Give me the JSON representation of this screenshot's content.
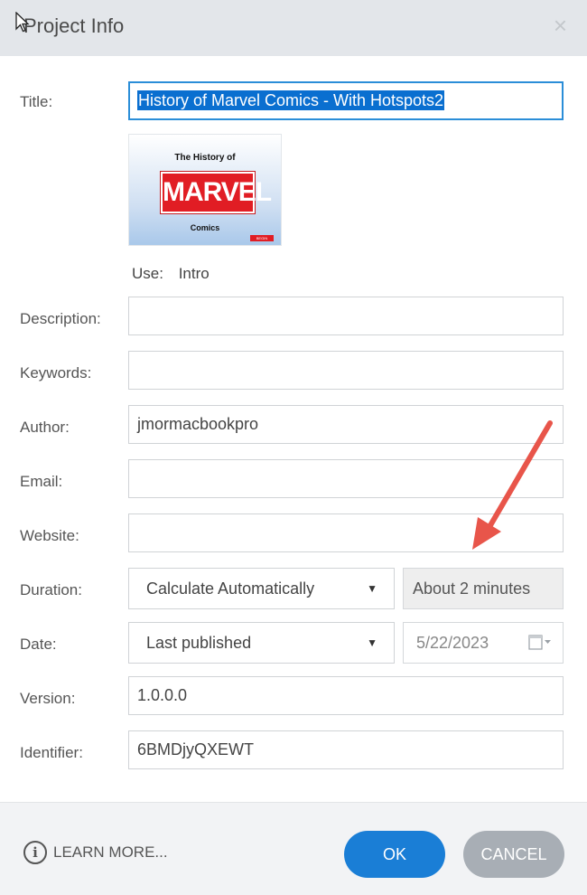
{
  "window": {
    "title": "Project Info",
    "close_glyph": "×"
  },
  "labels": {
    "title": "Title:",
    "description": "Description:",
    "keywords": "Keywords:",
    "author": "Author:",
    "email": "Email:",
    "website": "Website:",
    "duration": "Duration:",
    "date": "Date:",
    "version": "Version:",
    "identifier": "Identifier:"
  },
  "fields": {
    "title": "History of Marvel Comics - With Hotspots2",
    "description": "",
    "keywords": "",
    "author": "jmormacbookpro",
    "email": "",
    "website": "",
    "version": "1.0.0.0",
    "identifier": "6BMDjyQXEWT"
  },
  "thumbnail": {
    "line1": "The History of",
    "logo_text": "MARVEL",
    "line2": "Comics",
    "badge": "BEGIN"
  },
  "use": {
    "label": "Use:",
    "value": "Intro"
  },
  "duration": {
    "selected": "Calculate Automatically",
    "computed": "About 2 minutes"
  },
  "date": {
    "selected": "Last published",
    "value": "5/22/2023"
  },
  "footer": {
    "learn_more": "LEARN MORE...",
    "ok": "OK",
    "cancel": "CANCEL"
  },
  "colors": {
    "accent": "#1a7ed6",
    "annotation_arrow": "#e8554a",
    "selection": "#0a6fd0"
  },
  "icons": [
    "pointer-cursor-icon",
    "close-icon",
    "chevron-down-icon",
    "calendar-icon",
    "info-icon",
    "annotation-arrow-icon"
  ]
}
